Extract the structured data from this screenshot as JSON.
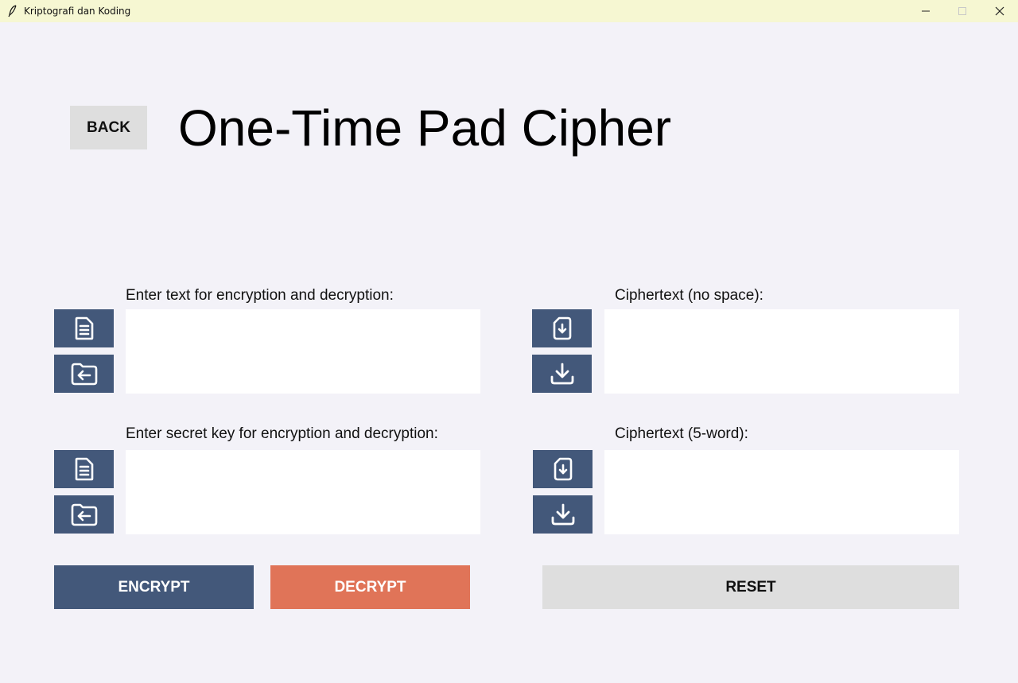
{
  "window": {
    "title": "Kriptografi dan Koding"
  },
  "header": {
    "back_label": "BACK",
    "page_title": "One-Time Pad Cipher"
  },
  "fields": {
    "plaintext_label": "Enter text for encryption and decryption:",
    "plaintext_value": "",
    "key_label": "Enter secret key for encryption and decryption:",
    "key_value": "",
    "cipher_nospace_label": "Ciphertext (no space):",
    "cipher_nospace_value": "",
    "cipher_5word_label": "Ciphertext (5-word):",
    "cipher_5word_value": ""
  },
  "actions": {
    "encrypt_label": "ENCRYPT",
    "decrypt_label": "DECRYPT",
    "reset_label": "RESET"
  },
  "icons": {
    "input_text": "document-text-icon",
    "open_file": "folder-open-icon",
    "save_file": "file-download-icon",
    "download": "download-icon"
  },
  "colors": {
    "primary": "#43587a",
    "decrypt": "#e07458",
    "neutral": "#dedede",
    "background": "#f3f2f8",
    "titlebar": "#f6f7d2"
  }
}
